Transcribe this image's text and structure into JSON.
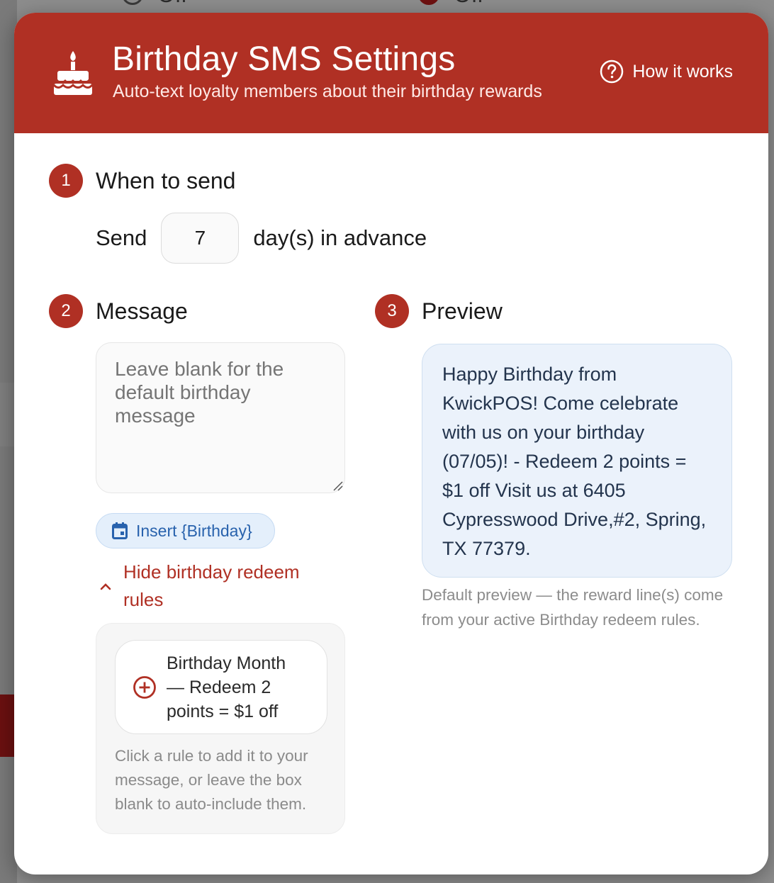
{
  "background": {
    "radio_options": [
      {
        "label": "Off",
        "selected": false
      },
      {
        "label": "Off",
        "selected": true
      }
    ]
  },
  "header": {
    "title": "Birthday SMS Settings",
    "subtitle": "Auto-text loyalty members about their birthday rewards",
    "help_link": "How it works",
    "icon": "cake-icon",
    "color": "#b03024"
  },
  "step1": {
    "number": "1",
    "title": "When to send",
    "send_label": "Send",
    "days_value": "7",
    "suffix": "day(s) in advance"
  },
  "step2": {
    "number": "2",
    "title": "Message",
    "placeholder": "Leave blank for the default birthday message",
    "insert_button": "Insert {Birthday}",
    "toggle_rules": "Hide birthday redeem rules",
    "rules": [
      {
        "label": "Birthday Month — Redeem 2 points = $1 off"
      }
    ],
    "rules_hint": "Click a rule to add it to your message, or leave the box blank to auto-include them."
  },
  "step3": {
    "number": "3",
    "title": "Preview",
    "preview_text": "Happy Birthday from KwickPOS! Come celebrate with us on your birthday (07/05)! - Redeem 2 points = $1 off Visit us at 6405 Cypresswood Drive,#2, Spring, TX 77379.",
    "note": "Default preview — the reward line(s) come from your active Birthday redeem rules."
  }
}
